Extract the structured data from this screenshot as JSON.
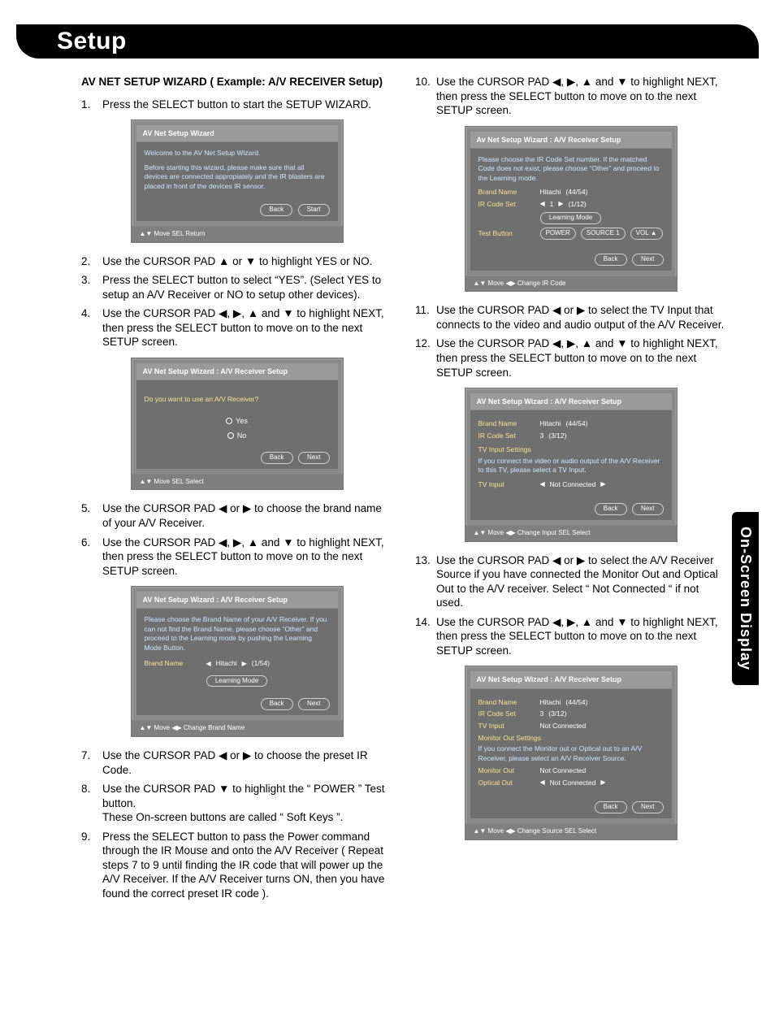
{
  "title": "Setup",
  "sideTab": "On-Screen Display",
  "sectionHead": "AV NET SETUP WIZARD ( Example: A/V RECEIVER Setup)",
  "left": {
    "s1": "Press the SELECT button to start the SETUP WIZARD.",
    "s2": "Use the CURSOR PAD ▲ or ▼ to highlight YES or NO.",
    "s3": "Press the SELECT button to select “YES”. (Select YES to setup an A/V Receiver or NO to setup other devices).",
    "s4": "Use the CURSOR PAD ◀, ▶, ▲ and ▼ to highlight NEXT, then press the SELECT button to move on to the next SETUP screen.",
    "s5": "Use the CURSOR PAD ◀ or ▶ to choose the brand name of your A/V Receiver.",
    "s6": "Use the CURSOR PAD ◀, ▶, ▲ and ▼ to highlight NEXT, then press the SELECT button to move on to the next SETUP screen.",
    "s7": "Use the CURSOR PAD ◀ or ▶ to choose the preset IR Code.",
    "s8": "Use the CURSOR PAD ▼ to highlight the “ POWER ” Test button.\nThese On-screen buttons are called “ Soft Keys ”.",
    "s9": "Press the SELECT button to pass the Power command through the IR Mouse and onto the A/V Receiver ( Repeat steps 7 to 9 until finding the IR code that will power up the A/V Receiver. If the A/V Receiver turns ON, then you have found the correct preset IR code )."
  },
  "right": {
    "s10": "Use the CURSOR PAD ◀, ▶, ▲ and ▼ to highlight NEXT, then press the SELECT button to move on to the next SETUP screen.",
    "s11": "Use the CURSOR PAD ◀ or ▶ to select the TV Input that connects  to the video and audio output of the A/V Receiver.",
    "s12": "Use the CURSOR PAD ◀, ▶, ▲ and ▼ to highlight NEXT, then press the SELECT button to move on to the next SETUP screen.",
    "s13": "Use the CURSOR PAD ◀ or ▶ to select the A/V Receiver Source if you have connected the Monitor Out and Optical Out to the A/V receiver. Select “ Not Connected “ if not used.",
    "s14": "Use the CURSOR PAD ◀, ▶, ▲ and ▼ to highlight NEXT, then press the SELECT button to move on to the next SETUP screen."
  },
  "osd1": {
    "hdr": "AV Net Setup Wizard",
    "line1": "Welcome to the AV Net Setup Wizard.",
    "line2": "Before starting this wizard, please make sure that all devices are connected appropiately and the IR blasters are placed in front of the devices IR sensor.",
    "back": "Back",
    "start": "Start",
    "foot": "▲▼  Move   SEL  Return"
  },
  "osd2": {
    "hdr": "AV Net Setup Wizard : A/V Receiver Setup",
    "q": "Do you want to use an A/V Receiver?",
    "yes": "Yes",
    "no": "No",
    "back": "Back",
    "next": "Next",
    "foot": "▲▼  Move   SEL  Select"
  },
  "osd3": {
    "hdr": "AV Net Setup Wizard : A/V Receiver Setup",
    "msg": "Please choose the Brand Name of your A/V Receiver. If you can not find the Brand Name, please choose “Other” and proceed to the Learning mode by pushing the Learning Mode Button.",
    "brandLab": "Brand Name",
    "brandVal": "Hitachi",
    "brandIdx": "(1/54)",
    "learn": "Learning Mode",
    "back": "Back",
    "next": "Next",
    "foot": "▲▼  Move   ◀▶ Change Brand Name"
  },
  "osd4": {
    "hdr": "Av Net Setup Wizard : A/V Receiver Setup",
    "msg": "Please choose the IR Code Set number. If the matched Code does not exist, please choose “Other” and proceed to the Learning mode.",
    "brandLab": "Brand Name",
    "brandVal": "Hitachi",
    "brandIdx": "(44/54)",
    "irLab": "IR Code Set",
    "irVal": "1",
    "irIdx": "(1/12)",
    "learn": "Learning Mode",
    "testLab": "Test Button",
    "pwr": "POWER",
    "src": "SOURCE 1",
    "vol": "VOL ▲",
    "back": "Back",
    "next": "Next",
    "foot": "▲▼  Move   ◀▶ Change IR Code"
  },
  "osd5": {
    "hdr": "AV Net Setup Wizard : A/V Receiver Setup",
    "brandLab": "Brand Name",
    "brandVal": "Hitachi",
    "brandIdx": "(44/54)",
    "irLab": "IR Code Set",
    "irVal": "3",
    "irIdx": "(3/12)",
    "tvHead": "TV Input Settings",
    "tvMsg": "If you connect the video or audio output of the A/V Receiver to this TV, please select a TV Input.",
    "tvLab": "TV Input",
    "tvVal": "Not Connected",
    "back": "Back",
    "next": "Next",
    "foot": "▲▼  Move   ◀▶ Change Input        SEL  Select"
  },
  "osd6": {
    "hdr": "AV Net Setup Wizard : A/V Receiver Setup",
    "brandLab": "Brand Name",
    "brandVal": "Hitachi",
    "brandIdx": "(44/54)",
    "irLab": "IR Code Set",
    "irVal": "3",
    "irIdx": "(3/12)",
    "tvLab": "TV Input",
    "tvVal": "Not Connected",
    "moHead": "Monitor Out Settings",
    "moMsg": "If you connect the Monitor out or Optical out to an A/V Receiver, please select an A/V Receiver Source.",
    "moLab": "Monitor Out",
    "moVal": "Not Connected",
    "ooLab": "Optical Out",
    "ooVal": "Not Connected",
    "back": "Back",
    "next": "Next",
    "foot": "▲▼  Move   ◀▶ Change Source       SEL  Select"
  }
}
